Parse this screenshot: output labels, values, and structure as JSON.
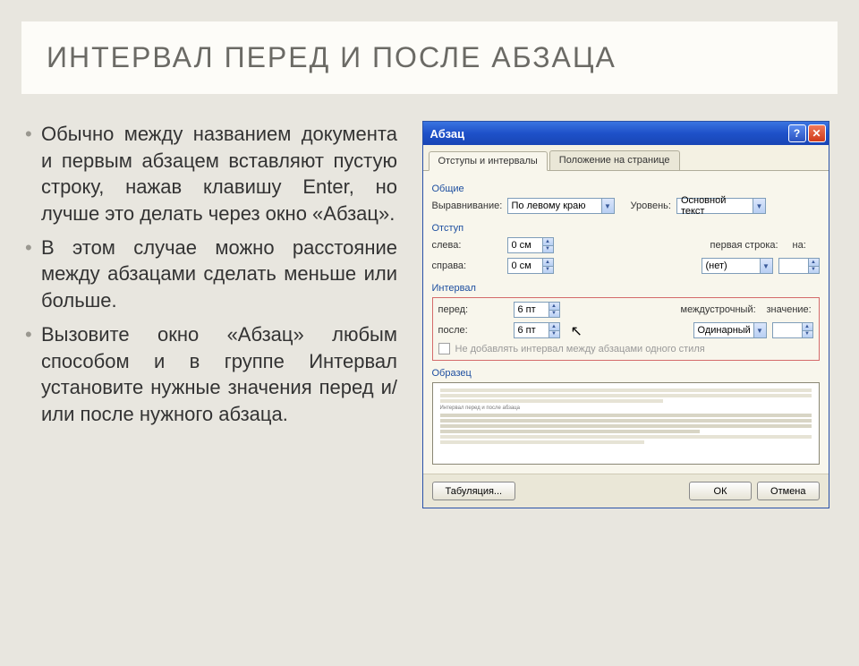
{
  "title": "ИНТЕРВАЛ ПЕРЕД И ПОСЛЕ АБЗАЦА",
  "bullets": [
    "Обычно между названием документа и первым абзацем вставляют пустую строку, нажав клавишу Enter, но лучше это делать через окно «Абзац».",
    "В этом случае можно расстояние между абзацами сделать меньше или больше.",
    "Вызовите окно «Абзац» любым способом и в группе Интервал установите нужные значения перед и/или после нужного абзаца."
  ],
  "dialog": {
    "title": "Абзац",
    "help_icon": "?",
    "close_icon": "✕",
    "tabs": {
      "active": "Отступы и интервалы",
      "other": "Положение на странице"
    },
    "groups": {
      "general": "Общие",
      "indent": "Отступ",
      "interval": "Интервал",
      "preview": "Образец"
    },
    "labels": {
      "align": "Выравнивание:",
      "level": "Уровень:",
      "left": "слева:",
      "right": "справа:",
      "firstline": "первая строка:",
      "on": "на:",
      "before": "перед:",
      "after": "после:",
      "linespacing": "междустрочный:",
      "value": "значение:",
      "checkbox": "Не добавлять интервал между абзацами одного стиля",
      "tabs_btn": "Табуляция...",
      "ok": "ОК",
      "cancel": "Отмена"
    },
    "values": {
      "align": "По левому краю",
      "level": "Основной текст",
      "left": "0 см",
      "right": "0 см",
      "firstline": "(нет)",
      "on": "",
      "before": "6 пт",
      "after": "6 пт",
      "linespacing": "Одинарный",
      "value": ""
    },
    "preview_title": "Интервал перед и после абзаца"
  }
}
